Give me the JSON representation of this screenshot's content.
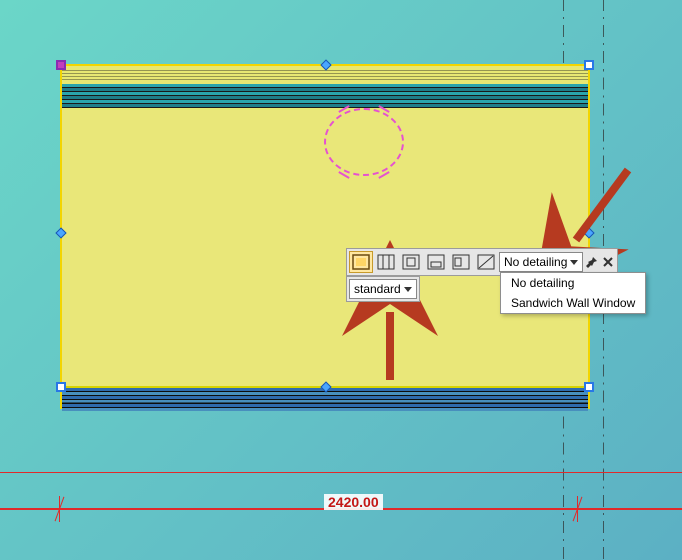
{
  "canvas": {
    "dimension": {
      "value": "2420.00"
    }
  },
  "toolbar": {
    "detailing_dropdown": {
      "selected": "No detailing",
      "options": [
        "No detailing",
        "Sandwich Wall Window"
      ]
    },
    "standard_dropdown": {
      "selected": "standard"
    }
  }
}
